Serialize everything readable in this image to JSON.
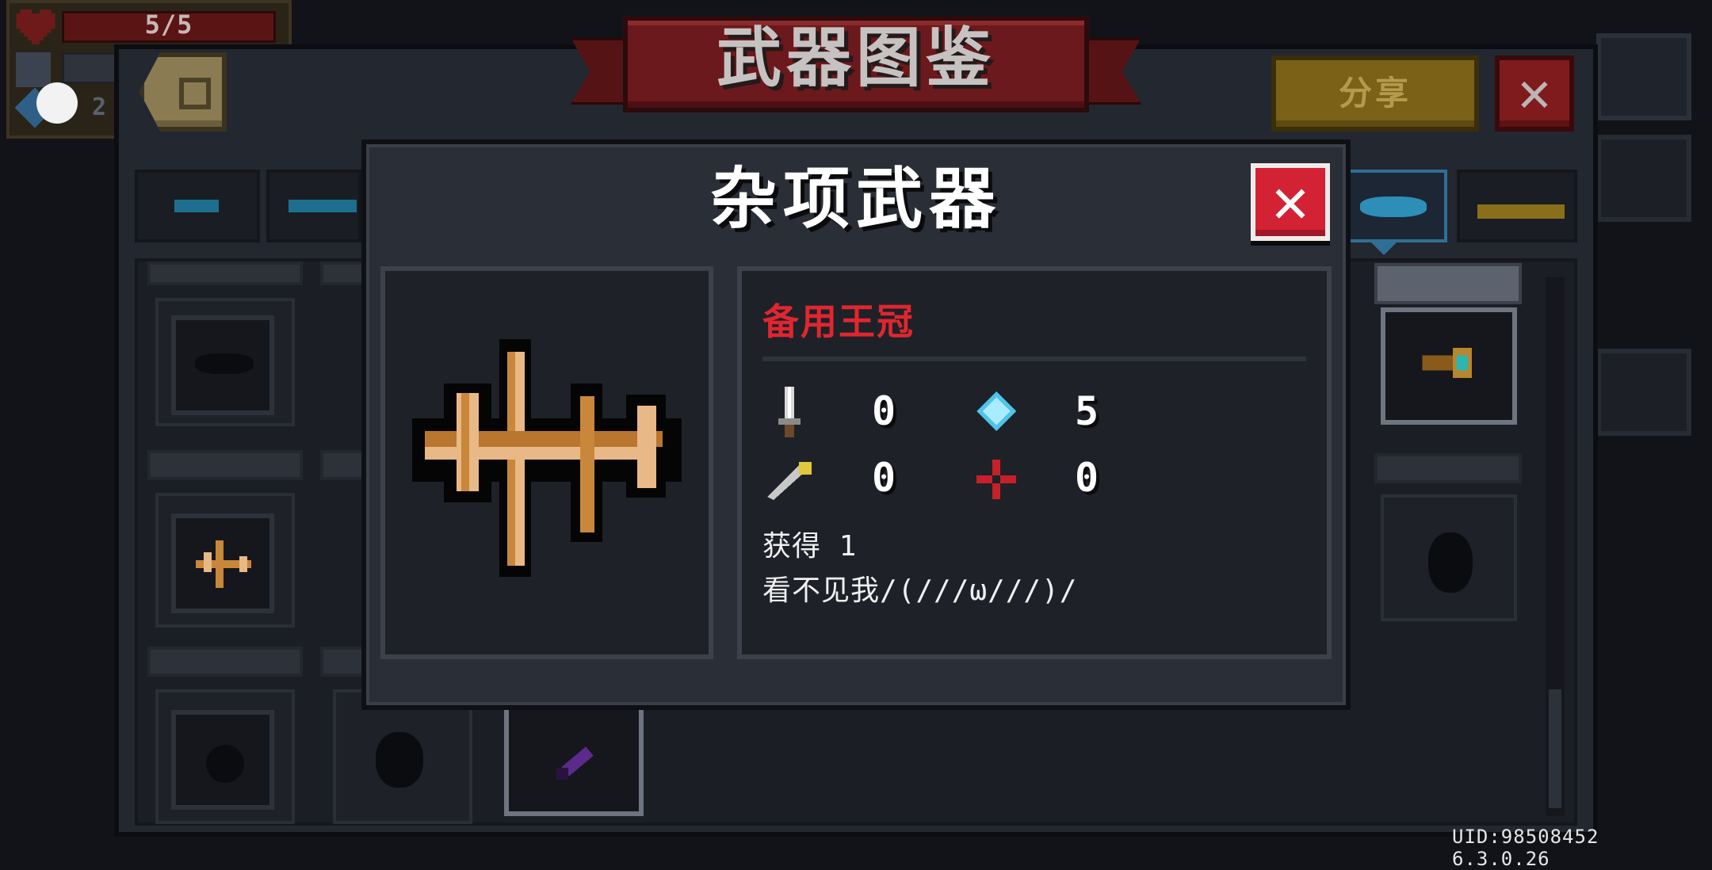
{
  "hud": {
    "hp_text": "5/5",
    "armor_text": "2"
  },
  "collection": {
    "title": "武器图鉴",
    "share_label": "分享",
    "close_glyph": "✕"
  },
  "dialog": {
    "title": "杂项武器",
    "close_glyph": "✕",
    "weapon_name": "备用王冠",
    "stats": {
      "damage": "0",
      "energy": "5",
      "crit": "0",
      "accuracy": "0"
    },
    "obtained_text": "获得 1",
    "description": "看不见我/(///ω///)/"
  },
  "footer": {
    "uid_text": "UID:98508452 6.3.0.26"
  },
  "icons": {
    "weapon": "crossbow-crown-icon",
    "damage": "sword-icon",
    "energy": "blue-diamond-icon",
    "crit": "dagger-icon",
    "accuracy": "crosshair-icon"
  },
  "colors": {
    "weapon_name": "#e0262f",
    "close_button": "#d32234",
    "banner": "#6b191c",
    "share_button": "#7a6117",
    "active_tab": "#2f6f95"
  }
}
